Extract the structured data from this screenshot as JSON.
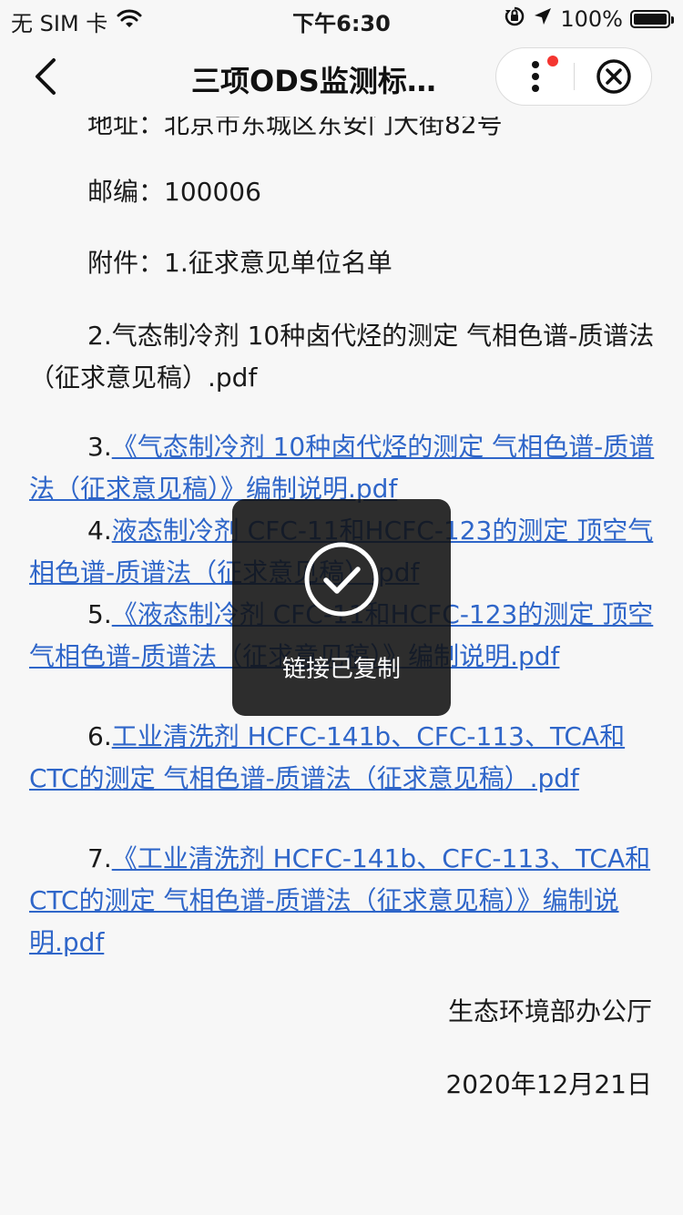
{
  "status_bar": {
    "carrier": "无 SIM 卡",
    "time": "下午6:30",
    "battery": "100%",
    "battery_level": 1.0
  },
  "nav": {
    "title": "三项ODS监测标…"
  },
  "document": {
    "address": "地址：北京市东城区东安门大街82号",
    "postcode": "邮编：100006",
    "attachment_1": "附件：1.征求意见单位名单",
    "attachment_2": "2.气态制冷剂 10种卤代烃的测定 气相色谱-质谱法（征求意见稿）.pdf",
    "attachment_3": {
      "num": "3.",
      "link": "《气态制冷剂 10种卤代烃的测定 气相色谱-质谱法（征求意见稿）》编制说明.pdf"
    },
    "attachment_4": {
      "num": "4.",
      "link": "液态制冷剂 CFC-11和HCFC-123的测定 顶空气相色谱-质谱法（征求意见稿）.pdf"
    },
    "attachment_5": {
      "num": "5.",
      "link": "《液态制冷剂 CFC-11和HCFC-123的测定 顶空气相色谱-质谱法（征求意见稿）》编制说明.pdf"
    },
    "attachment_6": {
      "num": "6.",
      "link": "工业清洗剂 HCFC-141b、CFC-113、TCA和CTC的测定 气相色谱-质谱法（征求意见稿）.pdf"
    },
    "attachment_7": {
      "num": "7.",
      "link": "《工业清洗剂 HCFC-141b、CFC-113、TCA和CTC的测定 气相色谱-质谱法（征求意见稿）》编制说明.pdf"
    },
    "issuer": "生态环境部办公厅",
    "date": "2020年12月21日"
  },
  "toast": {
    "message": "链接已复制",
    "icon": "check-circle-icon"
  }
}
